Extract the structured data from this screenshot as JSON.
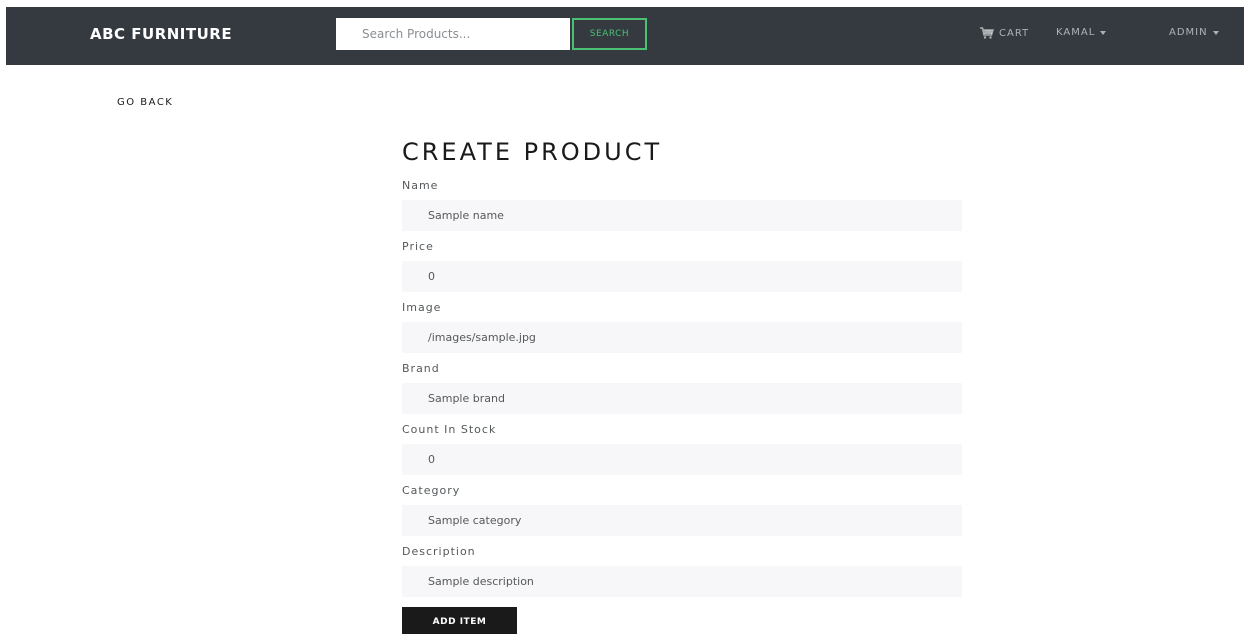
{
  "navbar": {
    "brand": "ABC FURNITURE",
    "search_placeholder": "Search Products...",
    "search_button": "SEARCH",
    "cart_label": "CART",
    "user_label": "KAMAL",
    "admin_label": "ADMIN",
    "background_color": "#343a40",
    "accent_color": "#4bbf73"
  },
  "go_back": "GO BACK",
  "form": {
    "title": "CREATE PRODUCT",
    "fields": [
      {
        "label": "Name",
        "value": "Sample name"
      },
      {
        "label": "Price",
        "value": "0"
      },
      {
        "label": "Image",
        "value": "/images/sample.jpg"
      },
      {
        "label": "Brand",
        "value": "Sample brand"
      },
      {
        "label": "Count In Stock",
        "value": "0"
      },
      {
        "label": "Category",
        "value": "Sample category"
      },
      {
        "label": "Description",
        "value": "Sample description"
      }
    ],
    "submit_label": "ADD ITEM"
  },
  "icons": {
    "cart": "shopping-cart-icon",
    "dropdown": "caret-down-icon"
  }
}
